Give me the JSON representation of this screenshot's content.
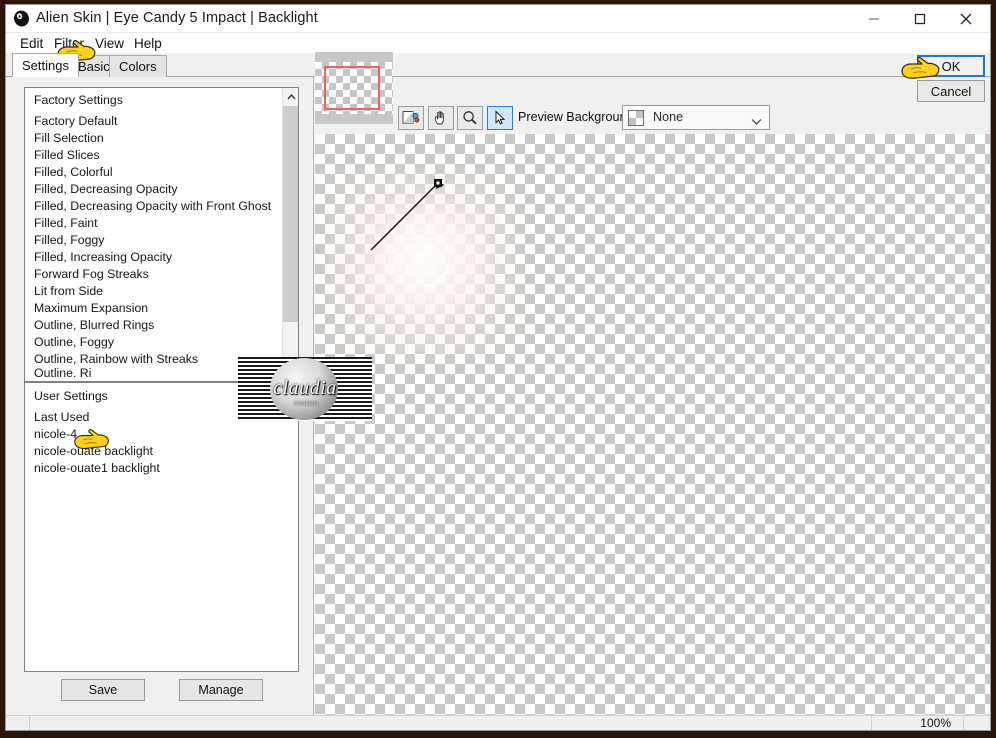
{
  "window": {
    "title": "Alien Skin | Eye Candy 5 Impact | Backlight",
    "icon": "alien-skin-logo-icon",
    "controls": {
      "minimize": "minimize-icon",
      "maximize": "maximize-icon",
      "close": "close-icon"
    }
  },
  "menubar": {
    "items": [
      {
        "label": "Edit"
      },
      {
        "label": "Filter"
      },
      {
        "label": "View"
      },
      {
        "label": "Help"
      }
    ]
  },
  "tabs": [
    {
      "label": "Settings",
      "active": true
    },
    {
      "label": "Basic",
      "active": false
    },
    {
      "label": "Colors",
      "active": false
    }
  ],
  "settings_panel": {
    "factory_list": {
      "header": "Factory Settings",
      "items": [
        "Factory Default",
        "Fill Selection",
        "Filled Slices",
        "Filled, Colorful",
        "Filled, Decreasing Opacity",
        "Filled, Decreasing Opacity with Front Ghost",
        "Filled, Faint",
        "Filled, Foggy",
        "Filled, Increasing Opacity",
        "Forward Fog Streaks",
        "Lit from Side",
        "Maximum Expansion",
        "Outline, Blurred Rings",
        "Outline, Foggy",
        "Outline, Rainbow with Streaks"
      ],
      "partial_item": "Outline, Ri"
    },
    "user_list": {
      "header": "User Settings",
      "items": [
        {
          "label": "Last Used",
          "selected": false
        },
        {
          "label": "nicole-4",
          "selected": true
        },
        {
          "label": "nicole-ouate backlight",
          "selected": false
        },
        {
          "label": "nicole-ouate1 backlight",
          "selected": false
        }
      ]
    },
    "buttons": {
      "save": "Save",
      "manage": "Manage"
    }
  },
  "preview_toolbar": {
    "tools": [
      {
        "name": "compare-view-icon",
        "active": false
      },
      {
        "name": "hand-pan-icon",
        "active": false
      },
      {
        "name": "zoom-magnifier-icon",
        "active": false
      },
      {
        "name": "arrow-select-icon",
        "active": true
      }
    ],
    "background_label": "Preview Background:",
    "background_value": "None",
    "background_swatch": "checkerboard-swatch-icon",
    "caret": "chevron-down-icon"
  },
  "preview": {
    "navigator_viewport_color": "#f4605e",
    "watermark": {
      "text": "claudia",
      "subtext": "creations"
    }
  },
  "dialog_buttons": {
    "ok": "OK",
    "cancel": "Cancel"
  },
  "statusbar": {
    "zoom": "100%"
  },
  "colors": {
    "selection_blue": "#0a6cd4",
    "focus_blue": "#1b78d0",
    "active_tool_blue": "#cfe6fb",
    "frame_brown": "#2b1408",
    "cursor_yellow": "#ffcc00"
  }
}
